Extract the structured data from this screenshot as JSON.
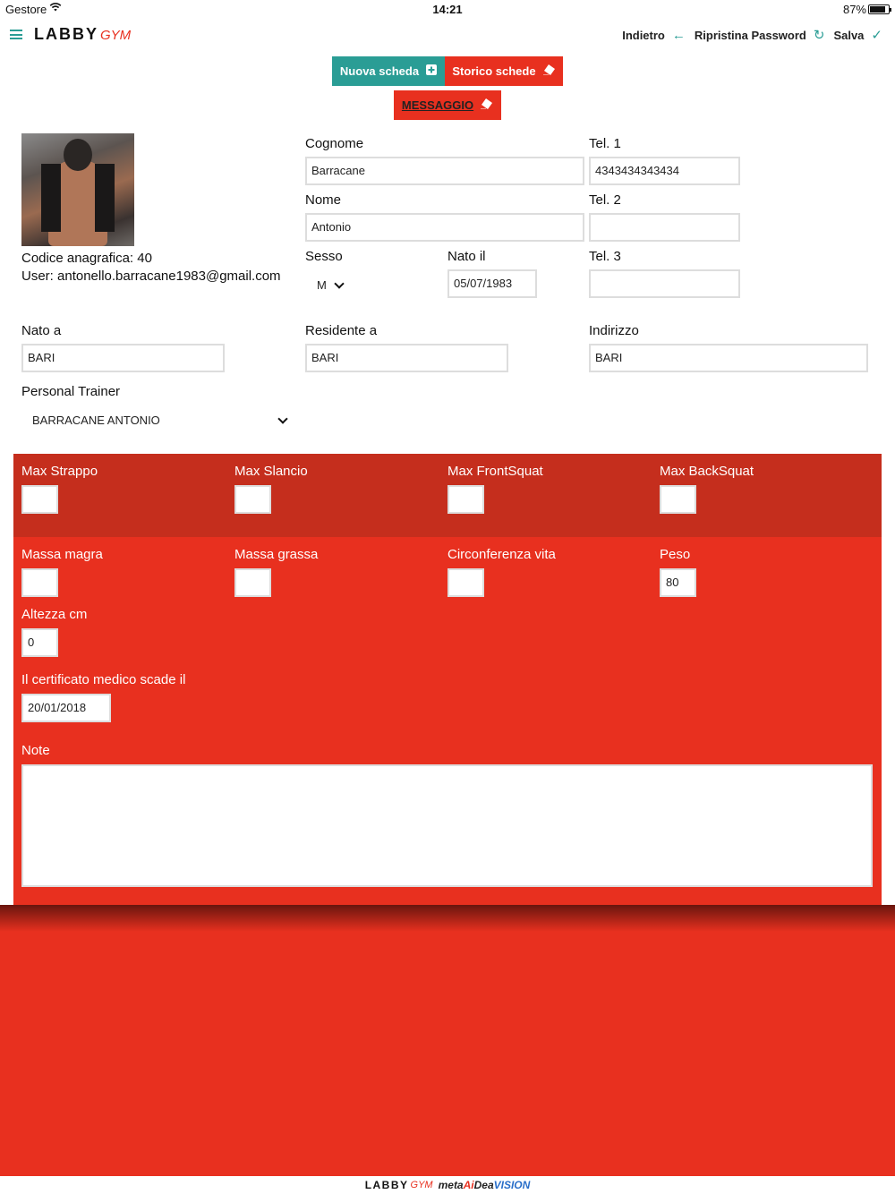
{
  "status_bar": {
    "carrier": "Gestore",
    "time": "14:21",
    "battery": "87%",
    "battery_level": 0.87
  },
  "navbar": {
    "logo_main": "LABBY",
    "logo_sub": "GYM",
    "back_label": "Indietro",
    "reset_password_label": "Ripristina Password",
    "save_label": "Salva"
  },
  "actions": {
    "new_sheet": "Nuova scheda",
    "history": "Storico schede",
    "message": "MESSAGGIO"
  },
  "profile": {
    "code": "Codice anagrafica: 40",
    "user": "User: antonello.barracane1983@gmail.com"
  },
  "form": {
    "cognome_label": "Cognome",
    "cognome_value": "Barracane",
    "nome_label": "Nome",
    "nome_value": "Antonio",
    "sesso_label": "Sesso",
    "sesso_value": "M",
    "nato_il_label": "Nato il",
    "nato_il_value": "05/07/1983",
    "tel1_label": "Tel. 1",
    "tel1_value": "4343434343434",
    "tel2_label": "Tel. 2",
    "tel2_value": "",
    "tel3_label": "Tel. 3",
    "tel3_value": "",
    "nato_a_label": "Nato a",
    "nato_a_value": "BARI",
    "residente_label": "Residente a",
    "residente_value": "BARI",
    "indirizzo_label": "Indirizzo",
    "indirizzo_value": "BARI",
    "trainer_label": "Personal Trainer",
    "trainer_value": "BARRACANE ANTONIO"
  },
  "maxes": {
    "strappo_label": "Max Strappo",
    "strappo_value": "",
    "slancio_label": "Max Slancio",
    "slancio_value": "",
    "frontsquat_label": "Max FrontSquat",
    "frontsquat_value": "",
    "backsquat_label": "Max BackSquat",
    "backsquat_value": ""
  },
  "body": {
    "massa_magra_label": "Massa magra",
    "massa_magra_value": "",
    "massa_grassa_label": "Massa grassa",
    "massa_grassa_value": "",
    "circonferenza_label": "Circonferenza vita",
    "circonferenza_value": "",
    "peso_label": "Peso",
    "peso_value": "80",
    "altezza_label": "Altezza cm",
    "altezza_value": "0",
    "certificato_label": "Il certificato medico scade il",
    "certificato_value": "20/01/2018",
    "note_label": "Note",
    "note_value": ""
  },
  "footer": {
    "labby": "LABBY",
    "gym": "GYM",
    "meta": "meta",
    "ai": "Ai",
    "dea": "Dea",
    "vision": "VISION"
  },
  "colors": {
    "teal": "#2a9d95",
    "red": "#e8301f",
    "dark_red": "#c52e1d"
  }
}
